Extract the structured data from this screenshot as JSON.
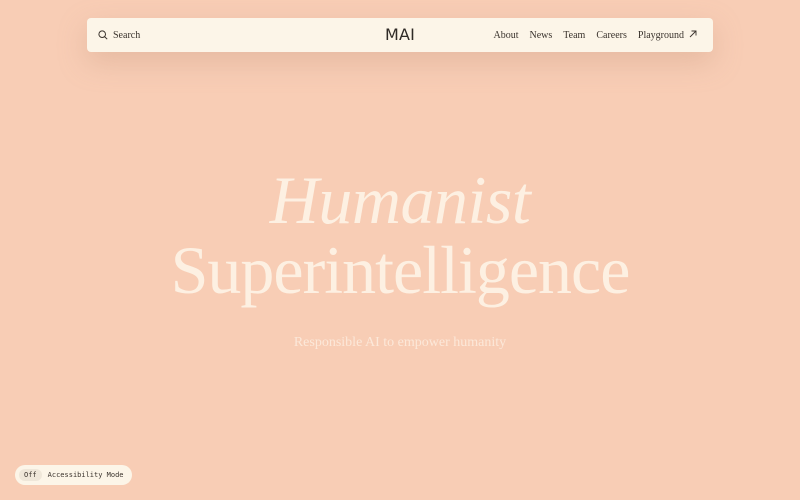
{
  "header": {
    "search_label": "Search",
    "brand": "MAI",
    "nav": [
      {
        "label": "About"
      },
      {
        "label": "News"
      },
      {
        "label": "Team"
      },
      {
        "label": "Careers"
      },
      {
        "label": "Playground",
        "icon": "arrow-up-right-icon"
      }
    ]
  },
  "hero": {
    "line1": "Humanist",
    "line2": "Superintelligence",
    "subtitle": "Responsible AI to empower humanity"
  },
  "accessibility": {
    "state": "Off",
    "label": "Accessibility Mode"
  },
  "colors": {
    "background": "#f8cdb5",
    "bar": "#fcf5e8",
    "text_dark": "#2f2a26",
    "hero_text": "#fdf0e2"
  }
}
